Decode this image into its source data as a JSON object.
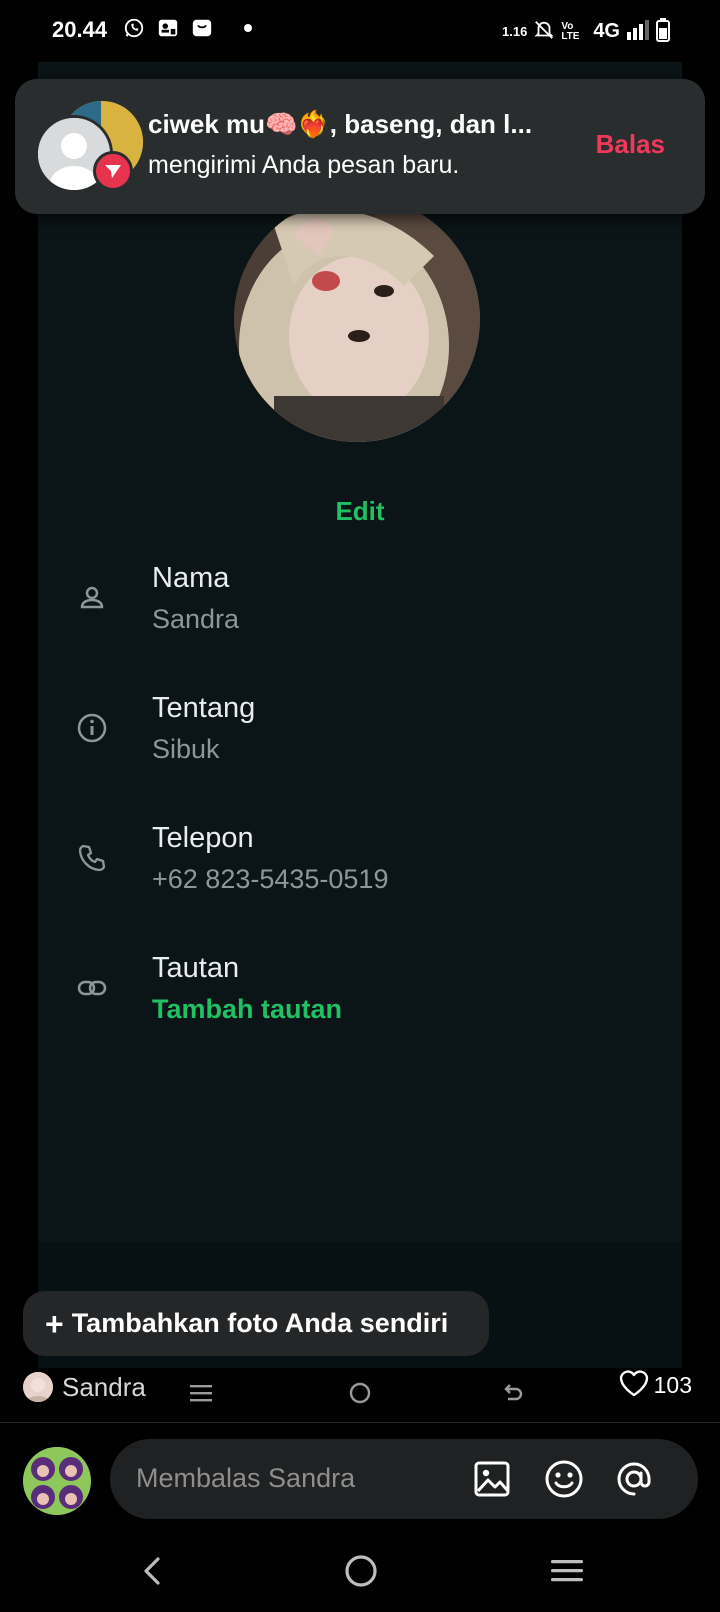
{
  "status_bar": {
    "time": "20.44",
    "network": "4G",
    "speed": "1.16",
    "volte": "Vo LTE"
  },
  "notification": {
    "title": "ciwek mu🧠❤️‍🔥, baseng, dan l...",
    "body": "mengirimi Anda pesan baru.",
    "action": "Balas"
  },
  "profile": {
    "edit_label": "Edit",
    "fields": [
      {
        "title": "Nama",
        "value": "Sandra",
        "icon": "person-icon"
      },
      {
        "title": "Tentang",
        "value": "Sibuk",
        "icon": "info-icon"
      },
      {
        "title": "Telepon",
        "value": "+62 823-5435-0519",
        "icon": "phone-icon"
      },
      {
        "title": "Tautan",
        "value": "Tambah tautan",
        "icon": "link-icon"
      }
    ]
  },
  "add_photo": {
    "plus": "+",
    "label": "Tambahkan foto Anda sendiri"
  },
  "story": {
    "author": "Sandra",
    "likes": "103"
  },
  "reply": {
    "placeholder": "Membalas Sandra"
  },
  "colors": {
    "accent_green": "#21c063",
    "accent_red": "#f1385a",
    "wa_bg": "#0b1416"
  }
}
